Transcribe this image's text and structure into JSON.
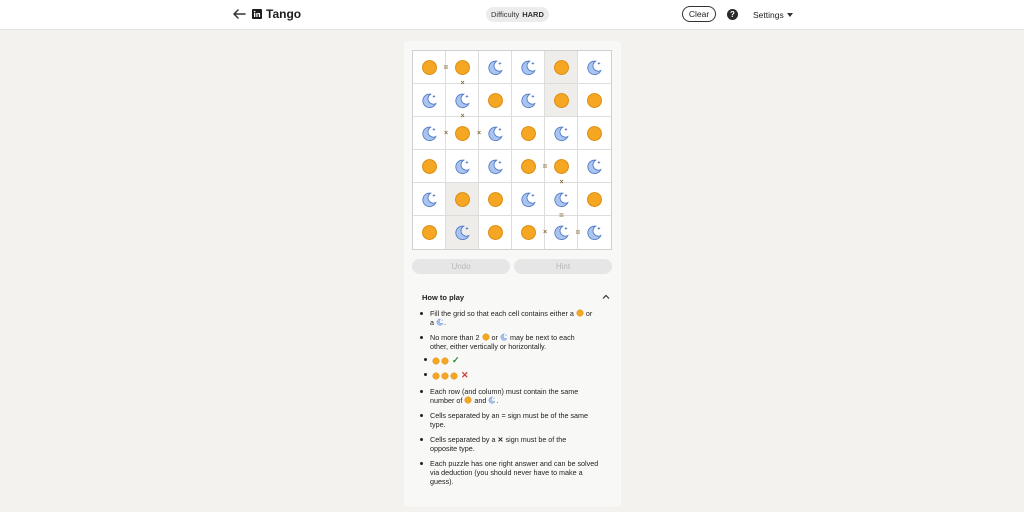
{
  "header": {
    "title": "Tango",
    "difficulty_label": "Difficulty",
    "difficulty_value": "HARD",
    "clear_label": "Clear",
    "help_symbol": "?",
    "settings_label": "Settings"
  },
  "board": {
    "rows": 6,
    "cols": 6,
    "cells": [
      [
        "sun",
        "sun",
        "moon",
        "moon",
        "sun",
        "moon"
      ],
      [
        "moon",
        "moon",
        "sun",
        "moon",
        "sun",
        "sun"
      ],
      [
        "moon",
        "sun",
        "moon",
        "sun",
        "moon",
        "sun"
      ],
      [
        "sun",
        "moon",
        "moon",
        "sun",
        "sun",
        "moon"
      ],
      [
        "moon",
        "sun",
        "sun",
        "moon",
        "moon",
        "sun"
      ],
      [
        "sun",
        "moon",
        "sun",
        "sun",
        "moon",
        "moon"
      ]
    ],
    "locked": [
      [
        0,
        4
      ],
      [
        1,
        4
      ],
      [
        4,
        1
      ],
      [
        5,
        1
      ]
    ],
    "signs": [
      {
        "r": 0,
        "c": 0,
        "dir": "right",
        "type": "="
      },
      {
        "r": 0,
        "c": 1,
        "dir": "down",
        "type": "x"
      },
      {
        "r": 1,
        "c": 1,
        "dir": "down",
        "type": "x"
      },
      {
        "r": 2,
        "c": 0,
        "dir": "right",
        "type": "x"
      },
      {
        "r": 2,
        "c": 1,
        "dir": "right",
        "type": "x"
      },
      {
        "r": 3,
        "c": 3,
        "dir": "right",
        "type": "="
      },
      {
        "r": 3,
        "c": 4,
        "dir": "down",
        "type": "x"
      },
      {
        "r": 4,
        "c": 4,
        "dir": "down",
        "type": "="
      },
      {
        "r": 5,
        "c": 3,
        "dir": "right",
        "type": "x"
      },
      {
        "r": 5,
        "c": 4,
        "dir": "right",
        "type": "="
      }
    ]
  },
  "controls": {
    "undo_label": "Undo",
    "hint_label": "Hint"
  },
  "how_to_play": {
    "title": "How to play",
    "rule1_a": "Fill the grid so that each cell contains either a",
    "rule1_b": "or",
    "rule1_c": "a",
    "rule1_d": ".",
    "rule2_a": "No more than 2",
    "rule2_b": "or",
    "rule2_c": "may be next to each",
    "rule2_d": "other, either vertically or horizontally.",
    "ok_mark": "✓",
    "bad_mark": "✕",
    "rule3_a": "Each row (and column) must contain the same",
    "rule3_b": "number of",
    "rule3_c": "and",
    "rule3_d": ".",
    "rule4_a": "Cells separated by an",
    "rule4_sign": "=",
    "rule4_b": "sign must be of the same",
    "rule4_c": "type.",
    "rule5_a": "Cells separated by a",
    "rule5_sign": "✕",
    "rule5_b": "sign must be of the",
    "rule5_c": "opposite type.",
    "rule6_a": "Each puzzle has one right answer and can be solved",
    "rule6_b": "via deduction (you should never have to make a",
    "rule6_c": "guess)."
  },
  "colors": {
    "sun_fill": "#f5a623",
    "sun_stroke": "#d98a0c",
    "moon_fill": "#a9c4ee",
    "moon_stroke": "#4f78c4"
  }
}
